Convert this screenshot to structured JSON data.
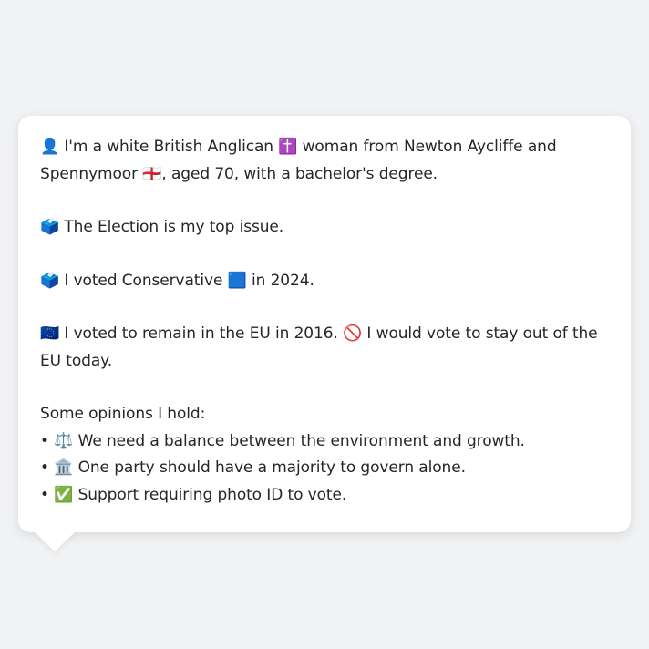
{
  "card": {
    "intro": "👤 I'm a white British Anglican ✝️ woman from Newton Aycliffe and Spennymoor 🏴󠁧󠁢󠁥󠁮󠁧󠁿, aged 70, with a bachelor's degree.",
    "top_issue": "🗳️ The Election is my top issue.",
    "vote_2024": "🗳️ I voted Conservative 🟦 in 2024.",
    "eu": "🇪🇺 I voted to remain in the EU in 2016. 🚫 I would vote to stay out of the EU today.",
    "opinions_heading": "Some opinions I hold:",
    "opinions": [
      "• ⚖️ We need a balance between the environment and growth.",
      "• 🏛️ One party should have a majority to govern alone.",
      "• ✅ Support requiring photo ID to vote."
    ]
  }
}
